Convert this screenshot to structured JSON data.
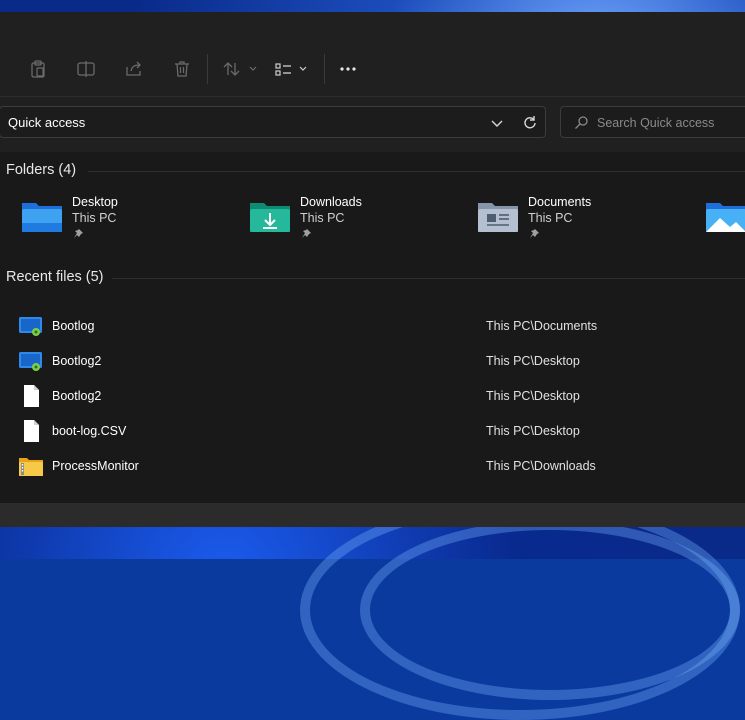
{
  "toolbar": {
    "buttons": [
      {
        "icon": "paste-icon"
      },
      {
        "icon": "rename-icon"
      },
      {
        "icon": "share-icon"
      },
      {
        "icon": "delete-icon"
      },
      {
        "icon": "sort-icon"
      },
      {
        "icon": "view-icon"
      },
      {
        "icon": "more-options-icon"
      }
    ]
  },
  "address": {
    "path": "Quick access"
  },
  "search": {
    "placeholder": "Search Quick access"
  },
  "folders_section": {
    "heading": "Folders (4)",
    "items": [
      {
        "name": "Desktop",
        "location": "This PC",
        "icon": "desktop-folder-icon"
      },
      {
        "name": "Downloads",
        "location": "This PC",
        "icon": "downloads-folder-icon"
      },
      {
        "name": "Documents",
        "location": "This PC",
        "icon": "documents-folder-icon"
      },
      {
        "name": "",
        "location": "",
        "icon": "pictures-folder-icon"
      }
    ]
  },
  "recent_section": {
    "heading": "Recent files (5)",
    "items": [
      {
        "name": "Bootlog",
        "path": "This PC\\Documents",
        "icon": "log-file-icon"
      },
      {
        "name": "Bootlog2",
        "path": "This PC\\Desktop",
        "icon": "log-file-icon"
      },
      {
        "name": "Bootlog2",
        "path": "This PC\\Desktop",
        "icon": "blank-file-icon"
      },
      {
        "name": "boot-log.CSV",
        "path": "This PC\\Desktop",
        "icon": "blank-file-icon"
      },
      {
        "name": "ProcessMonitor",
        "path": "This PC\\Downloads",
        "icon": "zip-folder-icon"
      }
    ]
  },
  "colors": {
    "window_bg": "#202020",
    "content_bg": "#191919",
    "accent": "#4cc2ff"
  }
}
